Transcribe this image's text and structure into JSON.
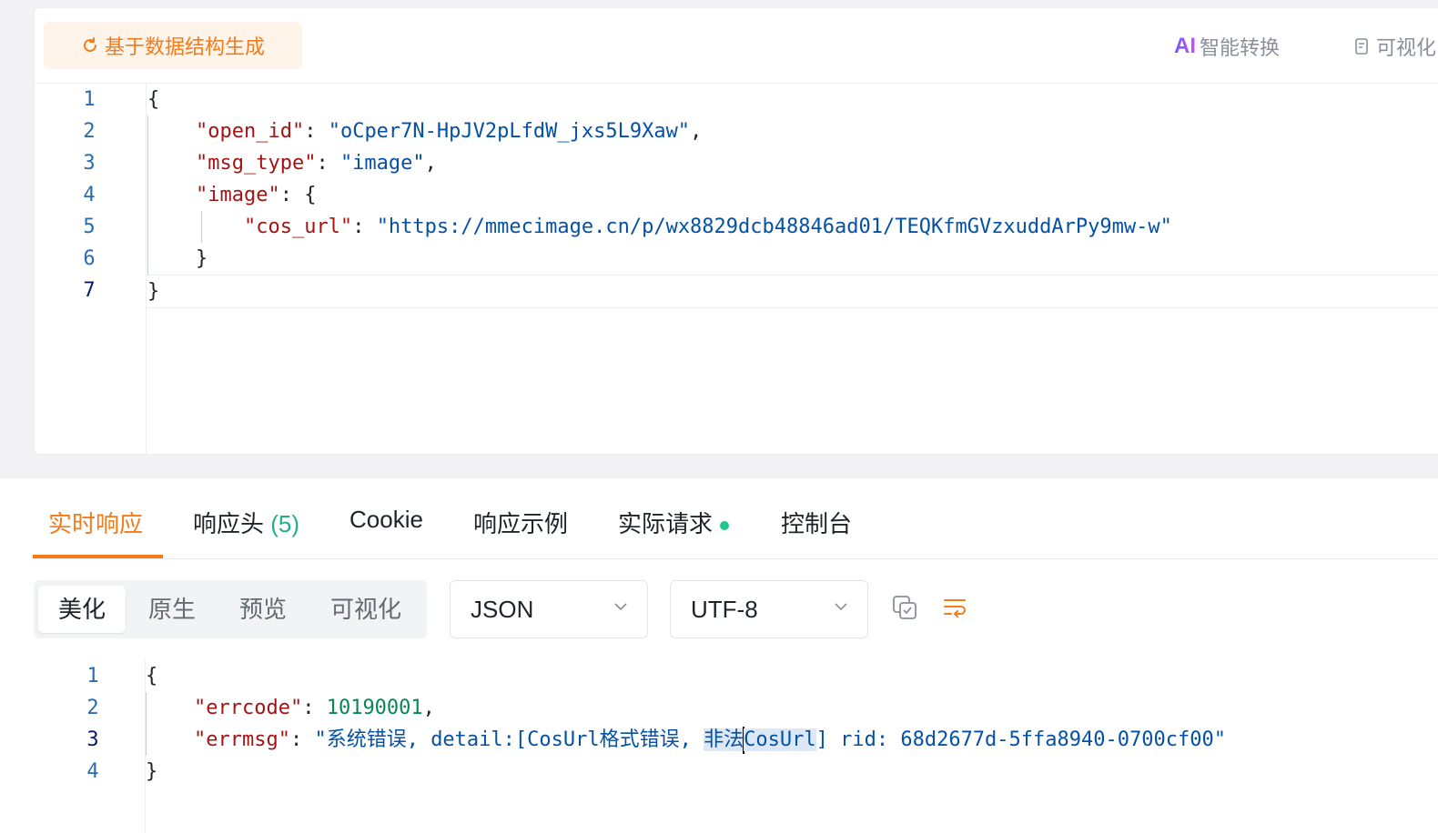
{
  "request": {
    "generate_button": "基于数据结构生成",
    "ai_button": "智能转换",
    "ai_logo": "AI",
    "visual_button": "可视化",
    "line_numbers": [
      "1",
      "2",
      "3",
      "4",
      "5",
      "6",
      "7"
    ],
    "json": {
      "open_id_key": "\"open_id\"",
      "open_id_value": "\"oCper7N-HpJV2pLfdW_jxs5L9Xaw\"",
      "msg_type_key": "\"msg_type\"",
      "msg_type_value": "\"image\"",
      "image_key": "\"image\"",
      "cos_url_key": "\"cos_url\"",
      "cos_url_value": "\"https://mmecimage.cn/p/wx8829dcb48846ad01/TEQKfmGVzxuddArPy9mw-w\""
    }
  },
  "response": {
    "tabs": {
      "realtime": "实时响应",
      "headers": "响应头",
      "headers_count": "(5)",
      "cookie": "Cookie",
      "example": "响应示例",
      "actual_request": "实际请求",
      "console": "控制台"
    },
    "view_modes": {
      "beautify": "美化",
      "raw": "原生",
      "preview": "预览",
      "visualize": "可视化"
    },
    "format_select": "JSON",
    "encoding_select": "UTF-8",
    "line_numbers": [
      "1",
      "2",
      "3",
      "4"
    ],
    "json": {
      "errcode_key": "\"errcode\"",
      "errcode_value": "10190001",
      "errmsg_key": "\"errmsg\"",
      "errmsg_value_part1": "\"系统错误, detail:[CosUrl格式错误, ",
      "errmsg_selected_a": "非法",
      "errmsg_selected_b": "CosUrl",
      "errmsg_value_part2": "] rid: 68d2677d-5ffa8940-0700cf00\""
    }
  },
  "colors": {
    "accent": "#f27b1c",
    "json_key": "#a31515",
    "json_string": "#0451a5",
    "json_number": "#098658",
    "status_dot": "#21c48f"
  }
}
